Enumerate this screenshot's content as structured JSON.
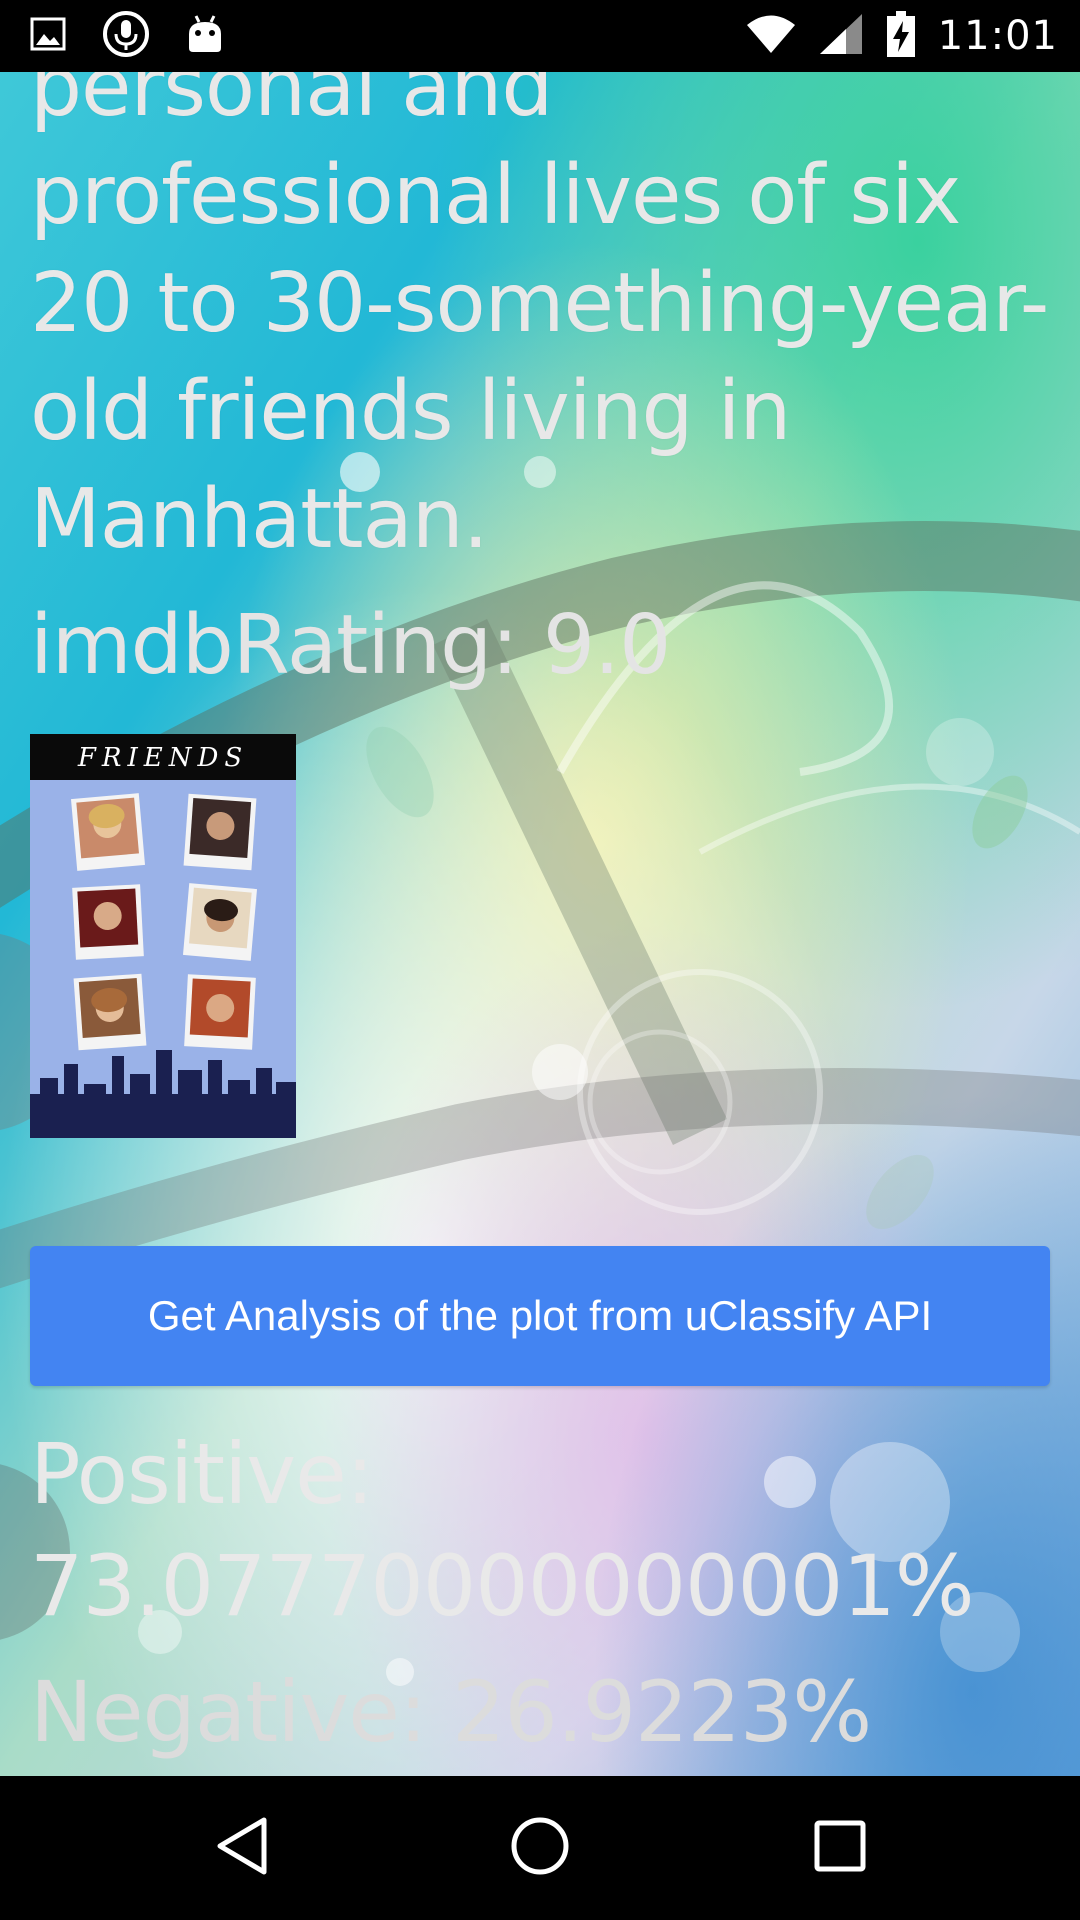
{
  "status_bar": {
    "time": "11:01",
    "left_icons": [
      "image-icon",
      "mic-icon",
      "android-icon"
    ],
    "right_icons": [
      "wifi-icon",
      "cell-signal-icon",
      "battery-charging-icon"
    ]
  },
  "movie": {
    "plot_lines": [
      "personal and",
      "professional lives of six",
      "20 to 30-something-year-",
      "old friends living in",
      "Manhattan."
    ],
    "rating_text": "imdbRating: 9.0",
    "poster": {
      "title": "FRIENDS"
    }
  },
  "analysis": {
    "button_label": "Get Analysis of the plot from uClassify API",
    "positive_text": "Positive: 73.07770000000001%",
    "negative_text": "Negative: 26.9223%"
  },
  "nav_bar": {
    "buttons": [
      "back-icon",
      "home-icon",
      "recents-icon"
    ]
  },
  "colors": {
    "button": "#4384f2",
    "text": "#e6e6e6",
    "bar": "#000000"
  }
}
